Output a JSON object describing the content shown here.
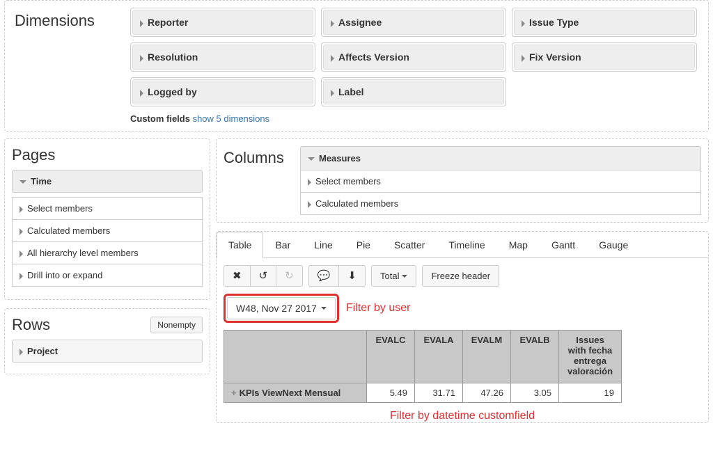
{
  "dimensions": {
    "title": "Dimensions",
    "row1": [
      {
        "label": "Reporter"
      },
      {
        "label": "Assignee"
      },
      {
        "label": "Issue Type"
      }
    ],
    "row2": [
      {
        "label": "Resolution"
      },
      {
        "label": "Affects Version"
      },
      {
        "label": "Fix Version"
      }
    ],
    "row3": [
      {
        "label": "Logged by"
      },
      {
        "label": "Label"
      }
    ],
    "custom_fields_prefix": "Custom fields ",
    "custom_fields_link": "show 5 dimensions"
  },
  "pages": {
    "title": "Pages",
    "time_label": "Time",
    "items": [
      "Select members",
      "Calculated members",
      "All hierarchy level members",
      "Drill into or expand"
    ]
  },
  "rows": {
    "title": "Rows",
    "nonempty_btn": "Nonempty",
    "project_label": "Project"
  },
  "columns": {
    "title": "Columns",
    "measures_label": "Measures",
    "sub_items": [
      "Select members",
      "Calculated members"
    ]
  },
  "tabs": [
    "Table",
    "Bar",
    "Line",
    "Pie",
    "Scatter",
    "Timeline",
    "Map",
    "Gantt",
    "Gauge"
  ],
  "toolbar": {
    "total_label": "Total",
    "freeze_label": "Freeze header"
  },
  "date_filter": {
    "label": "W48, Nov 27 2017",
    "note": "Filter by user"
  },
  "table": {
    "cols": [
      "EVALC",
      "EVALA",
      "EVALM",
      "EVALB",
      "Issues with fecha entrega valoración"
    ],
    "row_label": "KPIs ViewNext Mensual",
    "values": [
      "5.49",
      "31.71",
      "47.26",
      "3.05",
      "19"
    ]
  },
  "filter_note_bottom": "Filter by datetime customfield",
  "chart_data": {
    "type": "table",
    "columns": [
      "EVALC",
      "EVALA",
      "EVALM",
      "EVALB",
      "Issues with fecha entrega valoración"
    ],
    "rows": [
      {
        "label": "KPIs ViewNext Mensual",
        "values": [
          5.49,
          31.71,
          47.26,
          3.05,
          19
        ]
      }
    ]
  }
}
